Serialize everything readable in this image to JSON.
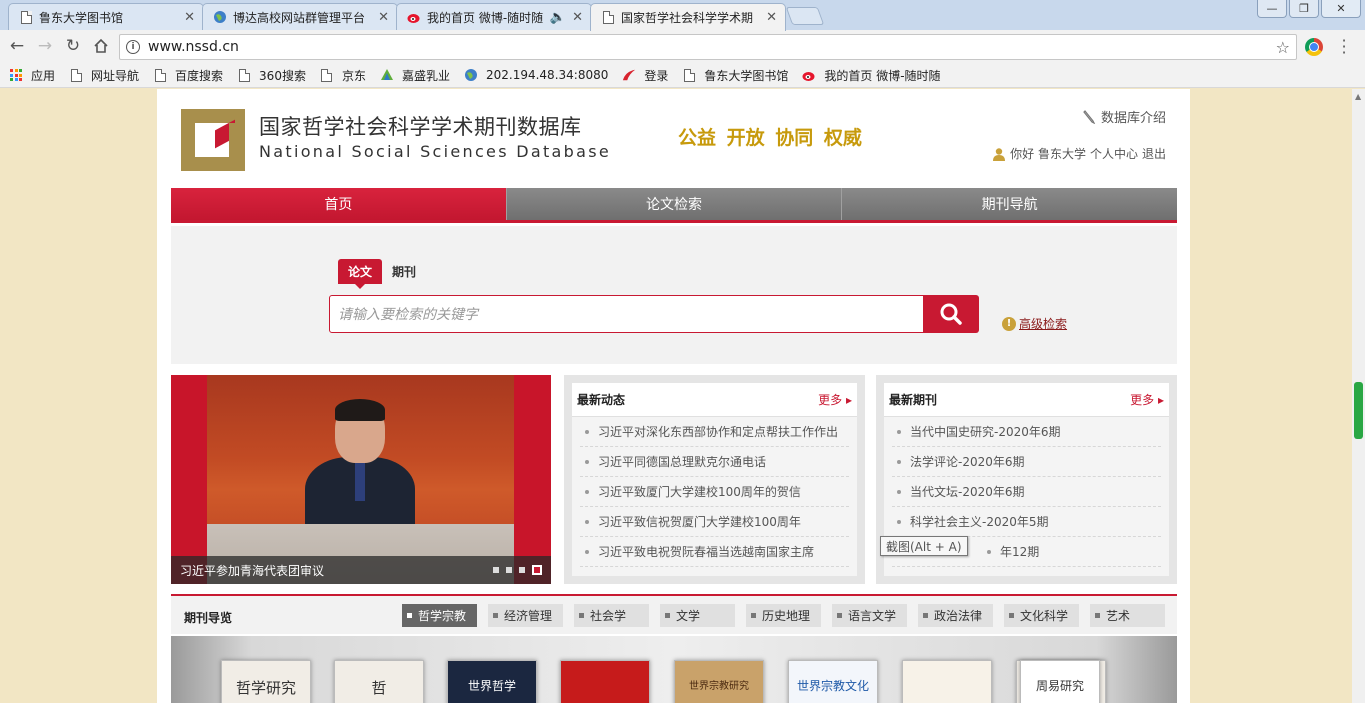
{
  "browser": {
    "tabs": [
      {
        "title": "鲁东大学图书馆",
        "icon": "page-icon"
      },
      {
        "title": "博达高校网站群管理平台",
        "icon": "globe-icon"
      },
      {
        "title": "我的首页 微博-随时随",
        "icon": "weibo-icon"
      },
      {
        "title": "国家哲学社会科学学术期",
        "icon": "page-icon"
      }
    ],
    "window_buttons": [
      "—",
      "❐",
      "✕"
    ],
    "url": "www.nssd.cn",
    "bookmarks": [
      {
        "label": "应用",
        "icon": "apps-icon"
      },
      {
        "label": "网址导航",
        "icon": "page-icon"
      },
      {
        "label": "百度搜索",
        "icon": "page-icon"
      },
      {
        "label": "360搜索",
        "icon": "page-icon"
      },
      {
        "label": "京东",
        "icon": "page-icon"
      },
      {
        "label": "嘉盛乳业",
        "icon": "tree-icon"
      },
      {
        "label": "202.194.48.34:8080",
        "icon": "globe-icon"
      },
      {
        "label": "登录",
        "icon": "chaoxing-icon"
      },
      {
        "label": "鲁东大学图书馆",
        "icon": "page-icon"
      },
      {
        "label": "我的首页 微博-随时随",
        "icon": "weibo-icon"
      }
    ]
  },
  "site": {
    "title_cn": "国家哲学社会科学学术期刊数据库",
    "title_en": "National Social Sciences Database",
    "slogan": "公益 开放 协同 权威",
    "db_intro": "数据库介绍",
    "user": {
      "greeting": "你好 鲁东大学",
      "center": "个人中心",
      "logout": "退出"
    },
    "nav": [
      "首页",
      "论文检索",
      "期刊导航"
    ],
    "search": {
      "tabs": [
        "论文",
        "期刊"
      ],
      "placeholder": "请输入要检索的关键字",
      "advanced": "高级检索"
    },
    "slider": {
      "caption": "习近平参加青海代表团审议",
      "dot_count": 4,
      "active_dot": 4
    },
    "news": {
      "title": "最新动态",
      "more": "更多",
      "items": [
        "习近平对深化东西部协作和定点帮扶工作作出",
        "习近平同德国总理默克尔通电话",
        "习近平致厦门大学建校100周年的贺信",
        "习近平致信祝贺厦门大学建校100周年",
        "习近平致电祝贺阮春福当选越南国家主席"
      ]
    },
    "journals": {
      "title": "最新期刊",
      "more": "更多",
      "items": [
        "当代中国史研究-2020年6期",
        "法学评论-2020年6期",
        "当代文坛-2020年6期",
        "科学社会主义-2020年5期",
        "年12期"
      ]
    },
    "tooltip": "截图(Alt + A)",
    "journal_nav": {
      "title": "期刊导览",
      "categories": [
        "哲学宗教",
        "经济管理",
        "社会学",
        "文学",
        "历史地理",
        "语言文学",
        "政治法律",
        "文化科学",
        "艺术"
      ]
    },
    "shelf_books": [
      "哲学研究",
      "哲",
      "世界哲学",
      "",
      "世界宗教研究",
      "世界宗教文化",
      "",
      "",
      "周易研究"
    ]
  }
}
